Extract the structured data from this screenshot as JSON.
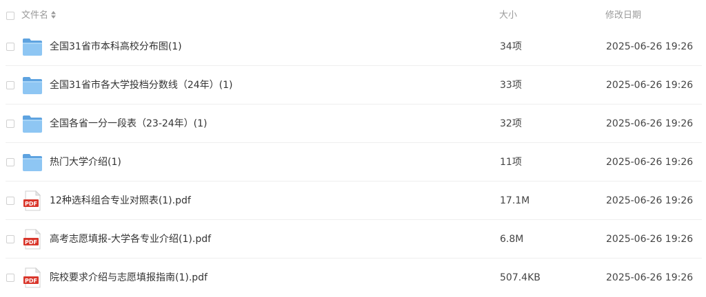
{
  "header": {
    "name_label": "文件名",
    "size_label": "大小",
    "date_label": "修改日期"
  },
  "colors": {
    "folder": "#7cb9ea",
    "pdf": "#d9362b",
    "border": "#eeeeee",
    "header_text": "#9a9a9a"
  },
  "files": [
    {
      "icon": "folder-icon",
      "name": "全国31省市本科高校分布图(1)",
      "size": "34项",
      "date": "2025-06-26 19:26"
    },
    {
      "icon": "folder-icon",
      "name": "全国31省市各大学投档分数线（24年）(1)",
      "size": "33项",
      "date": "2025-06-26 19:26"
    },
    {
      "icon": "folder-icon",
      "name": "全国各省一分一段表（23-24年）(1)",
      "size": "32项",
      "date": "2025-06-26 19:26"
    },
    {
      "icon": "folder-icon",
      "name": "热门大学介绍(1)",
      "size": "11项",
      "date": "2025-06-26 19:26"
    },
    {
      "icon": "pdf-icon",
      "icon_text": "PDF",
      "name": "12种选科组合专业对照表(1).pdf",
      "size": "17.1M",
      "date": "2025-06-26 19:26"
    },
    {
      "icon": "pdf-icon",
      "icon_text": "PDF",
      "name": "高考志愿填报-大学各专业介绍(1).pdf",
      "size": "6.8M",
      "date": "2025-06-26 19:26"
    },
    {
      "icon": "pdf-icon",
      "icon_text": "PDF",
      "name": "院校要求介绍与志愿填报指南(1).pdf",
      "size": "507.4KB",
      "date": "2025-06-26 19:26"
    }
  ]
}
